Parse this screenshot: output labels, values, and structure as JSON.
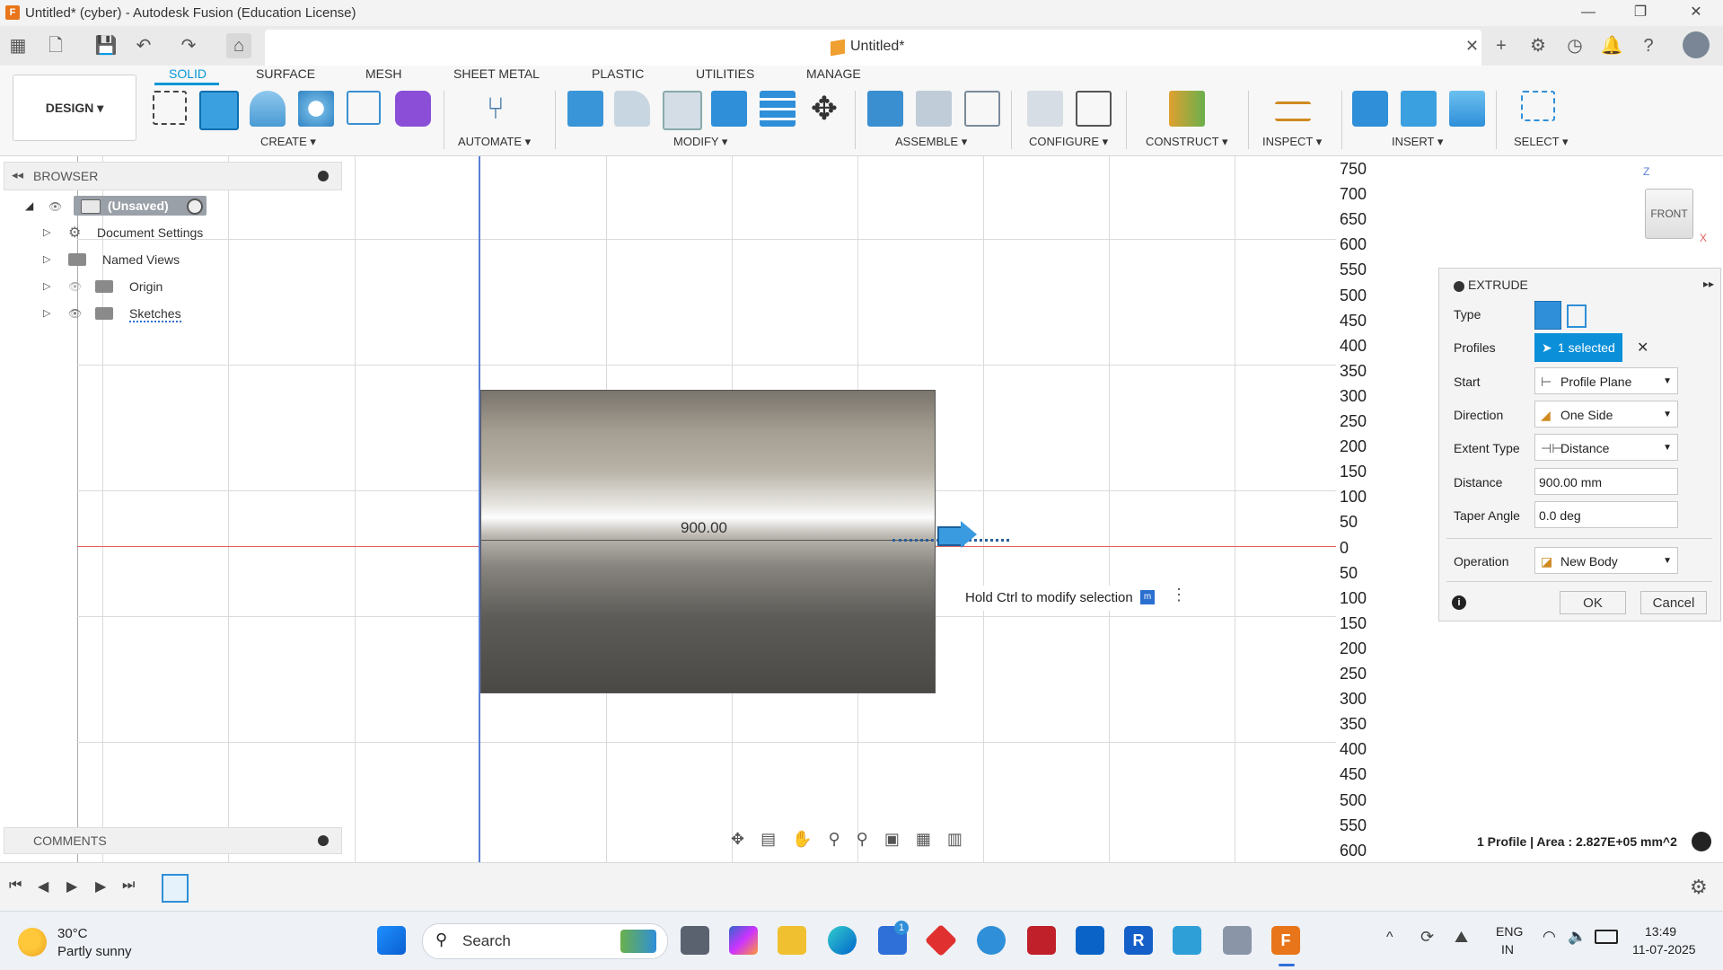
{
  "window": {
    "title": "Untitled* (cyber) - Autodesk Fusion (Education License)",
    "app_icon_letter": "F",
    "minimize": "—",
    "restore": "❐",
    "close": "✕"
  },
  "document_tab": {
    "name": "Untitled*",
    "close": "✕"
  },
  "toolbar": {
    "design_label": "DESIGN ▾",
    "workspace_tabs": [
      "SOLID",
      "SURFACE",
      "MESH",
      "SHEET METAL",
      "PLASTIC",
      "UTILITIES",
      "MANAGE"
    ],
    "groups": [
      "CREATE ▾",
      "AUTOMATE ▾",
      "MODIFY ▾",
      "ASSEMBLE ▾",
      "CONFIGURE ▾",
      "CONSTRUCT ▾",
      "INSPECT ▾",
      "INSERT ▾",
      "SELECT ▾"
    ],
    "accent": "#0696d7"
  },
  "browser": {
    "title": "BROWSER",
    "root": "(Unsaved)",
    "items": [
      "Document Settings",
      "Named Views",
      "Origin",
      "Sketches"
    ]
  },
  "viewport": {
    "dimension_label": "900.00",
    "hint": "Hold Ctrl to modify selection",
    "ruler_ticks": [
      "750",
      "700",
      "650",
      "600",
      "550",
      "500",
      "450",
      "400",
      "350",
      "300",
      "250",
      "200",
      "150",
      "100",
      "50",
      "0",
      "50",
      "100",
      "150",
      "200",
      "250",
      "300",
      "350",
      "400",
      "450",
      "500",
      "550",
      "600"
    ],
    "viewcube": {
      "face": "FRONT",
      "z_axis": "Z",
      "x_axis": "X"
    },
    "status": "1 Profile | Area : 2.827E+05 mm^2"
  },
  "extrude": {
    "title": "EXTRUDE",
    "labels": {
      "type": "Type",
      "profiles": "Profiles",
      "start": "Start",
      "direction": "Direction",
      "extent_type": "Extent Type",
      "distance": "Distance",
      "taper_angle": "Taper Angle",
      "operation": "Operation"
    },
    "values": {
      "profiles": "1 selected",
      "start": "Profile Plane",
      "direction": "One Side",
      "extent_type": "Distance",
      "distance": "900.00 mm",
      "taper_angle": "0.0 deg",
      "operation": "New Body"
    },
    "ok": "OK",
    "cancel": "Cancel"
  },
  "comments": {
    "title": "COMMENTS"
  },
  "taskbar": {
    "weather_temp": "30°C",
    "weather_desc": "Partly sunny",
    "search_placeholder": "Search",
    "lang": "ENG",
    "region": "IN",
    "time": "13:49",
    "date": "11-07-2025",
    "notification_badge": "1"
  }
}
